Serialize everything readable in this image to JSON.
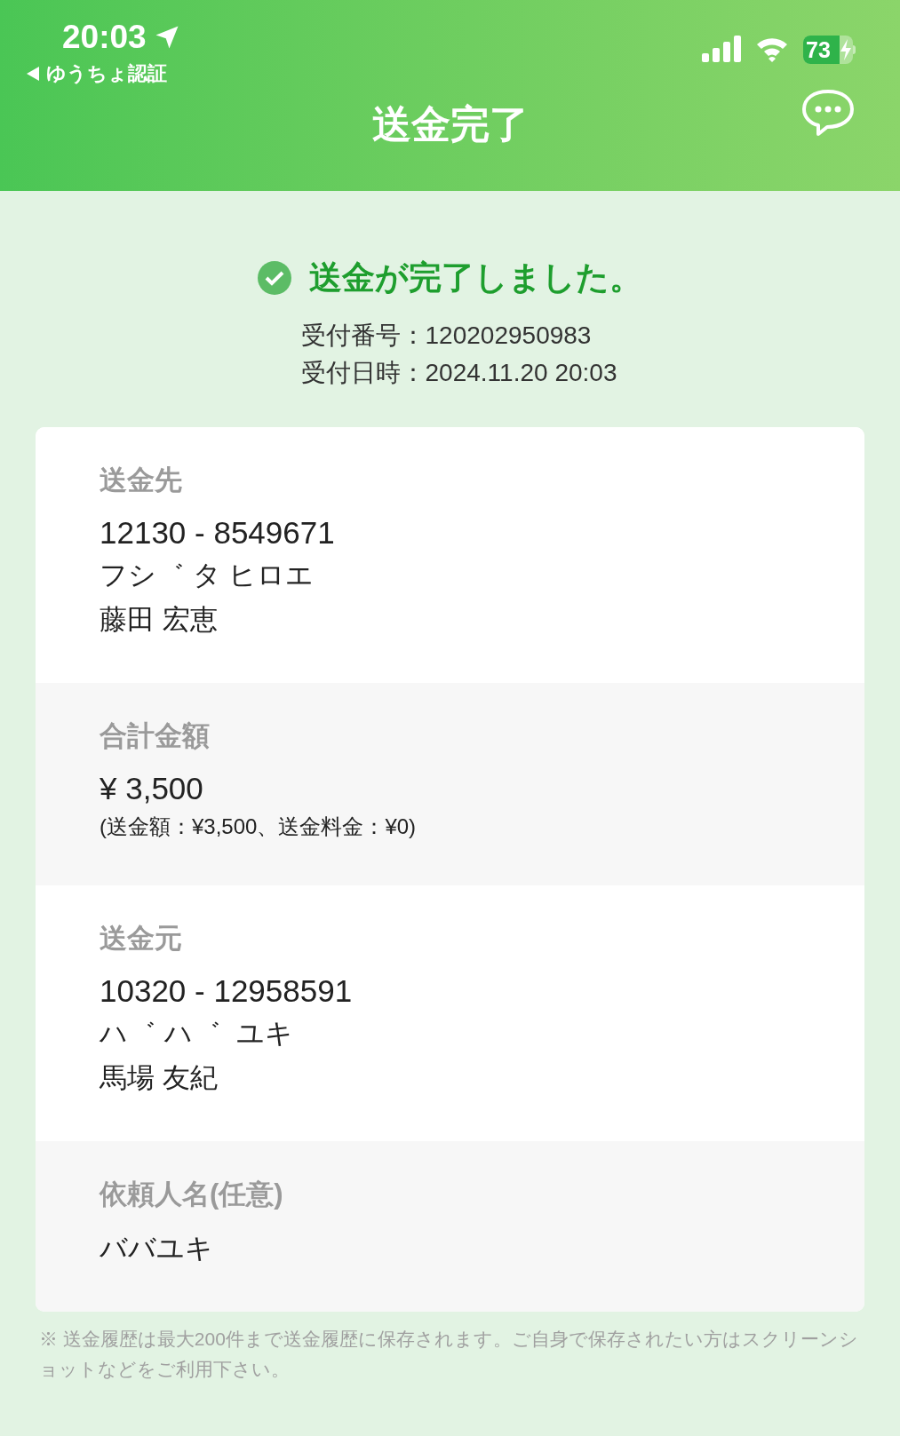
{
  "status_bar": {
    "time": "20:03",
    "back_label": "ゆうちょ認証",
    "battery": "73",
    "charging": true
  },
  "header": {
    "title": "送金完了"
  },
  "result": {
    "message": "送金が完了しました。",
    "lines": [
      "受付番号：120202950983",
      "受付日時：2024.11.20 20:03"
    ]
  },
  "sections": [
    {
      "label": "送金先",
      "lines": [
        {
          "kind": "large",
          "text": "12130 - 8549671"
        },
        {
          "kind": "normal",
          "text": "フシ゛ タ ヒロエ"
        },
        {
          "kind": "normal",
          "text": "藤田 宏恵"
        }
      ]
    },
    {
      "label": "合計金額",
      "lines": [
        {
          "kind": "large",
          "text": "¥ 3,500"
        },
        {
          "kind": "small",
          "text": "(送金額：¥3,500、送金料金：¥0)"
        }
      ]
    },
    {
      "label": "送金元",
      "lines": [
        {
          "kind": "large",
          "text": "10320 - 12958591"
        },
        {
          "kind": "normal",
          "text": "ハ゛ ハ゛  ユキ"
        },
        {
          "kind": "normal",
          "text": "馬場 友紀"
        }
      ]
    },
    {
      "label": "依頼人名(任意)",
      "lines": [
        {
          "kind": "normal",
          "text": "ババユキ"
        }
      ]
    }
  ],
  "footnote": "※ 送金履歴は最大200件まで送金履歴に保存されます。ご自身で保存されたい方はスクリーンショットなどをご利用下さい。"
}
